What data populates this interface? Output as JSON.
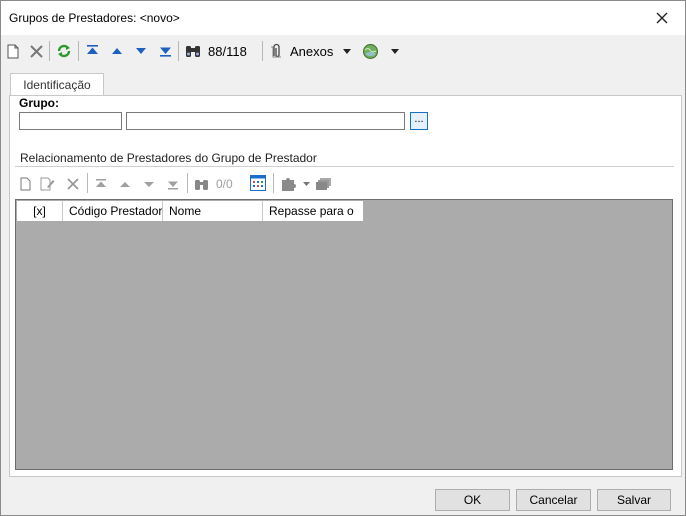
{
  "window": {
    "title": "Grupos de Prestadores: <novo>"
  },
  "toolbar": {
    "record_counter": "88/118",
    "anexos_label": "Anexos",
    "icons": [
      "new-document-icon",
      "delete-icon",
      "refresh-icon",
      "first-record-icon",
      "previous-record-icon",
      "next-record-icon",
      "last-record-icon",
      "search-binoculars-icon",
      "paperclip-icon",
      "dropdown-arrow-icon",
      "globe-icon",
      "dropdown-arrow-icon"
    ]
  },
  "tabs": [
    {
      "label": "Identificação",
      "active": true
    }
  ],
  "form": {
    "grupo_label": "Grupo:",
    "grupo_code_value": "",
    "grupo_name_value": "",
    "lookup_label": "..."
  },
  "relacionamento": {
    "title": "Relacionamento de Prestadores do Grupo de Prestador",
    "record_counter": "0/0",
    "columns": [
      "[x]",
      "Código Prestador",
      "Nome",
      "Repasse para o"
    ],
    "rows": []
  },
  "footer": {
    "ok_label": "OK",
    "cancel_label": "Cancelar",
    "save_label": "Salvar"
  },
  "colors": {
    "accent": "#1a6fc9",
    "grid_background": "#ababab",
    "window_background": "#f0f0f0",
    "refresh_green": "#2e9a2e",
    "nav_blue": "#1f5fbf"
  }
}
